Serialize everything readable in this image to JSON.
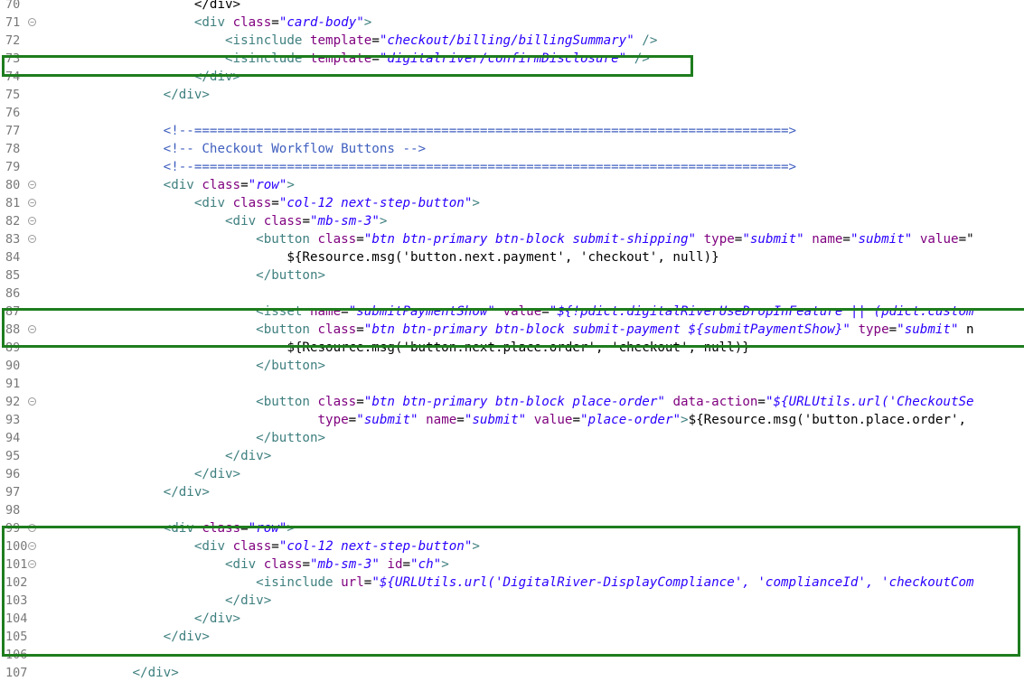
{
  "editor": {
    "lines": [
      {
        "n": "70",
        "fold": false,
        "parts": [
          {
            "c": "p",
            "t": "                    </div>"
          }
        ]
      },
      {
        "n": "71",
        "fold": true,
        "parts": [
          {
            "c": "p",
            "t": "                    "
          },
          {
            "c": "t",
            "t": "<div "
          },
          {
            "c": "a",
            "t": "class"
          },
          {
            "c": "p",
            "t": "="
          },
          {
            "c": "s",
            "t": "\"card-body\""
          },
          {
            "c": "t",
            "t": ">"
          }
        ]
      },
      {
        "n": "72",
        "fold": false,
        "parts": [
          {
            "c": "p",
            "t": "                        "
          },
          {
            "c": "t",
            "t": "<isinclude "
          },
          {
            "c": "a",
            "t": "template"
          },
          {
            "c": "p",
            "t": "="
          },
          {
            "c": "s",
            "t": "\"checkout/billing/billingSummary\""
          },
          {
            "c": "t",
            "t": " />"
          }
        ]
      },
      {
        "n": "73",
        "fold": false,
        "parts": [
          {
            "c": "p",
            "t": "                        "
          },
          {
            "c": "t",
            "t": "<isinclude "
          },
          {
            "c": "a",
            "t": "template"
          },
          {
            "c": "p",
            "t": "="
          },
          {
            "c": "s",
            "t": "\"digitalriver/confirmDisclosure\""
          },
          {
            "c": "t",
            "t": " />"
          }
        ]
      },
      {
        "n": "74",
        "fold": false,
        "parts": [
          {
            "c": "p",
            "t": "                    "
          },
          {
            "c": "t",
            "t": "</div>"
          }
        ]
      },
      {
        "n": "75",
        "fold": false,
        "parts": [
          {
            "c": "p",
            "t": "                "
          },
          {
            "c": "t",
            "t": "</div>"
          }
        ]
      },
      {
        "n": "76",
        "fold": false,
        "parts": []
      },
      {
        "n": "77",
        "fold": false,
        "parts": [
          {
            "c": "p",
            "t": "                "
          },
          {
            "c": "c",
            "t": "<!--=============================================================================>"
          }
        ]
      },
      {
        "n": "78",
        "fold": false,
        "parts": [
          {
            "c": "p",
            "t": "                "
          },
          {
            "c": "c",
            "t": "<!-- Checkout Workflow Buttons -->"
          }
        ]
      },
      {
        "n": "79",
        "fold": false,
        "parts": [
          {
            "c": "p",
            "t": "                "
          },
          {
            "c": "c",
            "t": "<!--=============================================================================>"
          }
        ]
      },
      {
        "n": "80",
        "fold": true,
        "parts": [
          {
            "c": "p",
            "t": "                "
          },
          {
            "c": "t",
            "t": "<div "
          },
          {
            "c": "a",
            "t": "class"
          },
          {
            "c": "p",
            "t": "="
          },
          {
            "c": "s",
            "t": "\"row\""
          },
          {
            "c": "t",
            "t": ">"
          }
        ]
      },
      {
        "n": "81",
        "fold": true,
        "parts": [
          {
            "c": "p",
            "t": "                    "
          },
          {
            "c": "t",
            "t": "<div "
          },
          {
            "c": "a",
            "t": "class"
          },
          {
            "c": "p",
            "t": "="
          },
          {
            "c": "s",
            "t": "\"col-12 next-step-button\""
          },
          {
            "c": "t",
            "t": ">"
          }
        ]
      },
      {
        "n": "82",
        "fold": true,
        "parts": [
          {
            "c": "p",
            "t": "                        "
          },
          {
            "c": "t",
            "t": "<div "
          },
          {
            "c": "a",
            "t": "class"
          },
          {
            "c": "p",
            "t": "="
          },
          {
            "c": "s",
            "t": "\"mb-sm-3\""
          },
          {
            "c": "t",
            "t": ">"
          }
        ]
      },
      {
        "n": "83",
        "fold": true,
        "parts": [
          {
            "c": "p",
            "t": "                            "
          },
          {
            "c": "t",
            "t": "<button "
          },
          {
            "c": "a",
            "t": "class"
          },
          {
            "c": "p",
            "t": "="
          },
          {
            "c": "s",
            "t": "\"btn btn-primary btn-block submit-shipping\""
          },
          {
            "c": "p",
            "t": " "
          },
          {
            "c": "a",
            "t": "type"
          },
          {
            "c": "p",
            "t": "="
          },
          {
            "c": "s",
            "t": "\"submit\""
          },
          {
            "c": "p",
            "t": " "
          },
          {
            "c": "a",
            "t": "name"
          },
          {
            "c": "p",
            "t": "="
          },
          {
            "c": "s",
            "t": "\"submit\""
          },
          {
            "c": "p",
            "t": " "
          },
          {
            "c": "a",
            "t": "value"
          },
          {
            "c": "p",
            "t": "=\""
          }
        ]
      },
      {
        "n": "84",
        "fold": false,
        "parts": [
          {
            "c": "p",
            "t": "                                ${Resource.msg('button.next.payment', 'checkout', null)}"
          }
        ]
      },
      {
        "n": "85",
        "fold": false,
        "parts": [
          {
            "c": "p",
            "t": "                            "
          },
          {
            "c": "t",
            "t": "</button>"
          }
        ]
      },
      {
        "n": "86",
        "fold": false,
        "parts": []
      },
      {
        "n": "87",
        "fold": false,
        "parts": [
          {
            "c": "p",
            "t": "                            "
          },
          {
            "c": "t",
            "t": "<isset "
          },
          {
            "c": "a",
            "t": "name"
          },
          {
            "c": "p",
            "t": "="
          },
          {
            "c": "s",
            "t": "\"submitPaymentShow\""
          },
          {
            "c": "p",
            "t": " "
          },
          {
            "c": "a",
            "t": "value"
          },
          {
            "c": "p",
            "t": "="
          },
          {
            "c": "s",
            "t": "\"${!pdict.digitalRiverUseDropInFeature || (pdict.custom"
          }
        ]
      },
      {
        "n": "88",
        "fold": true,
        "parts": [
          {
            "c": "p",
            "t": "                            "
          },
          {
            "c": "t",
            "t": "<button "
          },
          {
            "c": "a",
            "t": "class"
          },
          {
            "c": "p",
            "t": "="
          },
          {
            "c": "s",
            "t": "\"btn btn-primary btn-block submit-payment ${submitPaymentShow}\""
          },
          {
            "c": "p",
            "t": " "
          },
          {
            "c": "a",
            "t": "type"
          },
          {
            "c": "p",
            "t": "="
          },
          {
            "c": "s",
            "t": "\"submit\""
          },
          {
            "c": "p",
            "t": " n"
          }
        ]
      },
      {
        "n": "89",
        "fold": false,
        "parts": [
          {
            "c": "p",
            "t": "                                ${Resource.msg('button.next.place.order', 'checkout', null)}"
          }
        ]
      },
      {
        "n": "90",
        "fold": false,
        "parts": [
          {
            "c": "p",
            "t": "                            "
          },
          {
            "c": "t",
            "t": "</button>"
          }
        ]
      },
      {
        "n": "91",
        "fold": false,
        "parts": []
      },
      {
        "n": "92",
        "fold": true,
        "parts": [
          {
            "c": "p",
            "t": "                            "
          },
          {
            "c": "t",
            "t": "<button "
          },
          {
            "c": "a",
            "t": "class"
          },
          {
            "c": "p",
            "t": "="
          },
          {
            "c": "s",
            "t": "\"btn btn-primary btn-block place-order\""
          },
          {
            "c": "p",
            "t": " "
          },
          {
            "c": "a",
            "t": "data-action"
          },
          {
            "c": "p",
            "t": "="
          },
          {
            "c": "s",
            "t": "\"${URLUtils.url('CheckoutSe"
          }
        ]
      },
      {
        "n": "93",
        "fold": false,
        "parts": [
          {
            "c": "p",
            "t": "                                    "
          },
          {
            "c": "a",
            "t": "type"
          },
          {
            "c": "p",
            "t": "="
          },
          {
            "c": "s",
            "t": "\"submit\""
          },
          {
            "c": "p",
            "t": " "
          },
          {
            "c": "a",
            "t": "name"
          },
          {
            "c": "p",
            "t": "="
          },
          {
            "c": "s",
            "t": "\"submit\""
          },
          {
            "c": "p",
            "t": " "
          },
          {
            "c": "a",
            "t": "value"
          },
          {
            "c": "p",
            "t": "="
          },
          {
            "c": "s",
            "t": "\"place-order\""
          },
          {
            "c": "t",
            "t": ">"
          },
          {
            "c": "p",
            "t": "${Resource.msg('button.place.order', "
          }
        ]
      },
      {
        "n": "94",
        "fold": false,
        "parts": [
          {
            "c": "p",
            "t": "                            "
          },
          {
            "c": "t",
            "t": "</button>"
          }
        ]
      },
      {
        "n": "95",
        "fold": false,
        "parts": [
          {
            "c": "p",
            "t": "                        "
          },
          {
            "c": "t",
            "t": "</div>"
          }
        ]
      },
      {
        "n": "96",
        "fold": false,
        "parts": [
          {
            "c": "p",
            "t": "                    "
          },
          {
            "c": "t",
            "t": "</div>"
          }
        ]
      },
      {
        "n": "97",
        "fold": false,
        "parts": [
          {
            "c": "p",
            "t": "                "
          },
          {
            "c": "t",
            "t": "</div>"
          }
        ]
      },
      {
        "n": "98",
        "fold": false,
        "parts": []
      },
      {
        "n": "99",
        "fold": true,
        "parts": [
          {
            "c": "p",
            "t": "                "
          },
          {
            "c": "t",
            "t": "<div "
          },
          {
            "c": "a",
            "t": "class"
          },
          {
            "c": "p",
            "t": "="
          },
          {
            "c": "s",
            "t": "\"row\""
          },
          {
            "c": "t",
            "t": ">"
          }
        ]
      },
      {
        "n": "100",
        "fold": true,
        "parts": [
          {
            "c": "p",
            "t": "                    "
          },
          {
            "c": "t",
            "t": "<div "
          },
          {
            "c": "a",
            "t": "class"
          },
          {
            "c": "p",
            "t": "="
          },
          {
            "c": "s",
            "t": "\"col-12 next-step-button\""
          },
          {
            "c": "t",
            "t": ">"
          }
        ]
      },
      {
        "n": "101",
        "fold": true,
        "parts": [
          {
            "c": "p",
            "t": "                        "
          },
          {
            "c": "t",
            "t": "<div "
          },
          {
            "c": "a",
            "t": "class"
          },
          {
            "c": "p",
            "t": "="
          },
          {
            "c": "s",
            "t": "\"mb-sm-3\""
          },
          {
            "c": "p",
            "t": " "
          },
          {
            "c": "a",
            "t": "id"
          },
          {
            "c": "p",
            "t": "="
          },
          {
            "c": "s",
            "t": "\"ch\""
          },
          {
            "c": "t",
            "t": ">"
          }
        ]
      },
      {
        "n": "102",
        "fold": false,
        "parts": [
          {
            "c": "p",
            "t": "                            "
          },
          {
            "c": "t",
            "t": "<isinclude "
          },
          {
            "c": "a",
            "t": "url"
          },
          {
            "c": "p",
            "t": "="
          },
          {
            "c": "s",
            "t": "\"${URLUtils.url('DigitalRiver-DisplayCompliance', 'complianceId', 'checkoutCom"
          }
        ]
      },
      {
        "n": "103",
        "fold": false,
        "parts": [
          {
            "c": "p",
            "t": "                        "
          },
          {
            "c": "t",
            "t": "</div>"
          }
        ]
      },
      {
        "n": "104",
        "fold": false,
        "parts": [
          {
            "c": "p",
            "t": "                    "
          },
          {
            "c": "t",
            "t": "</div>"
          }
        ]
      },
      {
        "n": "105",
        "fold": false,
        "parts": [
          {
            "c": "p",
            "t": "                "
          },
          {
            "c": "t",
            "t": "</div>"
          }
        ]
      },
      {
        "n": "106",
        "fold": false,
        "parts": []
      },
      {
        "n": "107",
        "fold": false,
        "parts": [
          {
            "c": "p",
            "t": "            "
          },
          {
            "c": "t",
            "t": "</div>"
          }
        ]
      }
    ],
    "highlights": [
      {
        "name": "highlight-line-73"
      },
      {
        "name": "highlight-lines-87-88"
      },
      {
        "name": "highlight-lines-99-105"
      }
    ],
    "colors": {
      "tag": "#3f7f7f",
      "attribute": "#7f007f",
      "string": "#2a00ff",
      "comment": "#3f5fbf",
      "highlight_border": "#1e7d1e",
      "line_number": "#787878"
    }
  }
}
